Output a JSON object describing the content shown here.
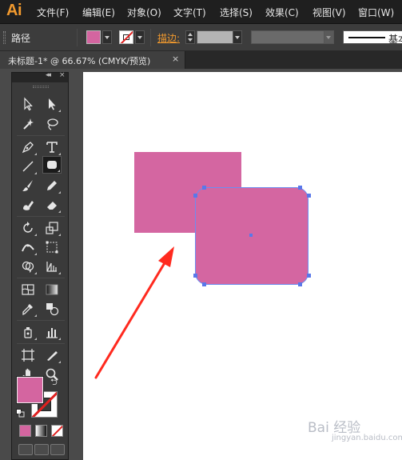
{
  "app": {
    "logo": "Ai",
    "menus": [
      "文件(F)",
      "编辑(E)",
      "对象(O)",
      "文字(T)",
      "选择(S)",
      "效果(C)",
      "视图(V)",
      "窗口(W)"
    ]
  },
  "control_bar": {
    "selection_label": "路径",
    "fill_color": "#d465a0",
    "stroke_label": "描边:",
    "brush_text": "基本"
  },
  "document": {
    "tab_title": "未标题-1* @ 66.67% (CMYK/预览)",
    "close_glyph": "×"
  },
  "toolbox": {
    "collapse_glyph": "◂◂",
    "close_glyph": "×",
    "fill_color": "#d465a0",
    "stroke_color": "none",
    "tools": [
      "selection-tool",
      "direct-selection-tool",
      "magic-wand-tool",
      "lasso-tool",
      "pen-tool",
      "type-tool",
      "line-segment-tool",
      "rounded-rectangle-tool",
      "paintbrush-tool",
      "pencil-tool",
      "blob-brush-tool",
      "eraser-tool",
      "rotate-tool",
      "scale-tool",
      "width-tool",
      "free-transform-tool",
      "shape-builder-tool",
      "perspective-grid-tool",
      "mesh-tool",
      "gradient-tool",
      "eyedropper-tool",
      "blend-tool",
      "symbol-sprayer-tool",
      "column-graph-tool",
      "artboard-tool",
      "slice-tool",
      "hand-tool",
      "zoom-tool"
    ]
  },
  "canvas": {
    "shape_color": "#d466a1",
    "selection_color": "#5978ea",
    "arrow_color": "#ff2a1f"
  },
  "watermark": {
    "text": "Bai 经验",
    "sub": "jingyan.baidu.com"
  }
}
